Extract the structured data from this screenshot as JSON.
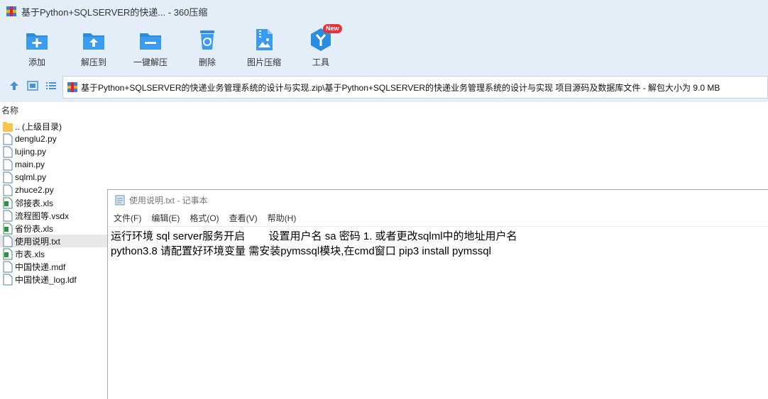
{
  "window": {
    "title": "基于Python+SQLSERVER的快递... - 360压缩"
  },
  "toolbar": {
    "buttons": [
      {
        "label": "添加",
        "icon": "add-icon"
      },
      {
        "label": "解压到",
        "icon": "extract-to-icon"
      },
      {
        "label": "一键解压",
        "icon": "one-click-extract-icon"
      },
      {
        "label": "删除",
        "icon": "recycle-bin-icon"
      },
      {
        "label": "图片压缩",
        "icon": "image-compress-icon"
      },
      {
        "label": "工具",
        "icon": "tools-icon",
        "badge": "New"
      }
    ]
  },
  "pathbar": {
    "path": "基于Python+SQLSERVER的快递业务管理系统的设计与实现.zip\\基于Python+SQLSERVER的快递业务管理系统的设计与实现 项目源码及数据库文件 - 解包大小为 9.0 MB"
  },
  "file_list": {
    "header": "名称",
    "items": [
      {
        "name": ".. (上级目录)",
        "type": "folder"
      },
      {
        "name": "denglu2.py",
        "type": "file"
      },
      {
        "name": "lujing.py",
        "type": "file"
      },
      {
        "name": "main.py",
        "type": "file"
      },
      {
        "name": "sqlml.py",
        "type": "file"
      },
      {
        "name": "zhuce2.py",
        "type": "file"
      },
      {
        "name": "邻接表.xls",
        "type": "excel"
      },
      {
        "name": "流程图等.vsdx",
        "type": "file"
      },
      {
        "name": "省份表.xls",
        "type": "excel"
      },
      {
        "name": "使用说明.txt",
        "type": "file",
        "selected": true
      },
      {
        "name": "市表.xls",
        "type": "excel"
      },
      {
        "name": "中国快递.mdf",
        "type": "file"
      },
      {
        "name": "中国快递_log.ldf",
        "type": "file"
      }
    ]
  },
  "notepad": {
    "title": "使用说明.txt - 记事本",
    "menu": [
      "文件(F)",
      "编辑(E)",
      "格式(O)",
      "查看(V)",
      "帮助(H)"
    ],
    "lines": [
      "运行环境 sql server服务开启        设置用户名 sa 密码 1. 或者更改sqlml中的地址用户名",
      "python3.8 请配置好环境变量 需安装pymssql模块,在cmd窗口 pip3 install pymssql"
    ]
  },
  "colors": {
    "accent_blue": "#2a8de0",
    "badge_red": "#e8323a",
    "toolbar_bg": "#e3eef9"
  }
}
